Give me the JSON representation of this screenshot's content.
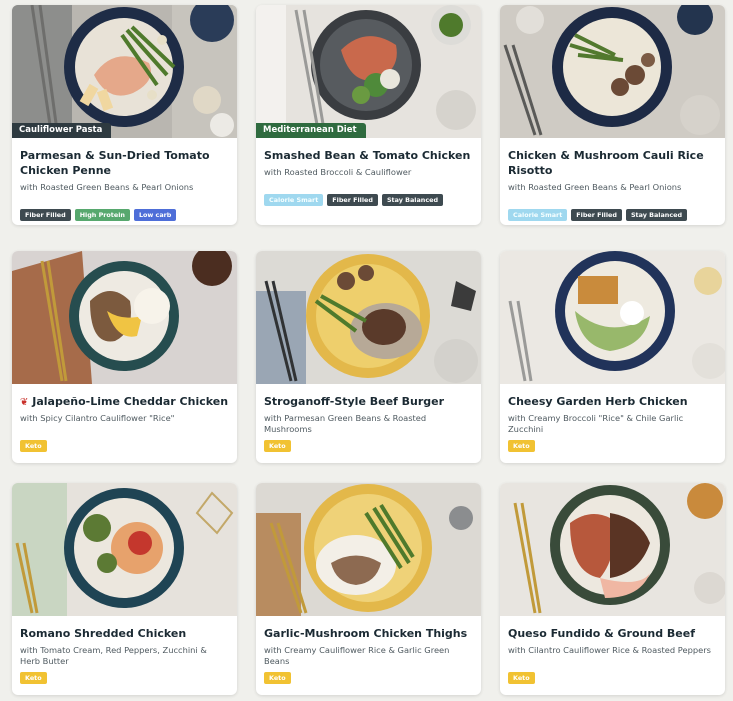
{
  "colors": {
    "background": "#f0f0ec",
    "cauliflower_pasta_tag": "#2e3a40",
    "mediterranean_tag": "#2f6b3f",
    "fiber_filled": "#3e4a50",
    "high_protein": "#57a86e",
    "low_carb": "#4e6ed8",
    "calorie_smart": "#9fd8ef",
    "stay_balanced": "#3e4a50",
    "keto": "#f1c232"
  },
  "meals": [
    {
      "diet_tag": "Cauliflower Pasta",
      "title": "Parmesan & Sun-Dried Tomato Chicken Penne",
      "subtitle": "with Roasted Green Beans & Pearl Onions",
      "badges": [
        "Fiber Filled",
        "High Protein",
        "Low carb"
      ]
    },
    {
      "diet_tag": "Mediterranean Diet",
      "title": "Smashed Bean & Tomato Chicken",
      "subtitle": "with Roasted Broccoli & Cauliflower",
      "badges": [
        "Calorie Smart",
        "Fiber Filled",
        "Stay Balanced"
      ]
    },
    {
      "title": "Chicken & Mushroom Cauli Rice Risotto",
      "subtitle": "with Roasted Green Beans & Pearl Onions",
      "badges": [
        "Calorie Smart",
        "Fiber Filled",
        "Stay Balanced"
      ]
    },
    {
      "title_icon": "chili-pepper-icon",
      "title": "Jalapeño-Lime Cheddar Chicken",
      "subtitle": "with Spicy Cilantro Cauliflower \"Rice\"",
      "badges": [
        "Keto"
      ]
    },
    {
      "title": "Stroganoff-Style Beef Burger",
      "subtitle": "with Parmesan Green Beans & Roasted Mushrooms",
      "badges": [
        "Keto"
      ]
    },
    {
      "title": "Cheesy Garden Herb Chicken",
      "subtitle": "with Creamy Broccoli \"Rice\" & Chile Garlic Zucchini",
      "badges": [
        "Keto"
      ]
    },
    {
      "title": "Romano Shredded Chicken",
      "subtitle": "with Tomato Cream, Red Peppers, Zucchini & Herb Butter",
      "badges": [
        "Keto"
      ]
    },
    {
      "title": "Garlic-Mushroom Chicken Thighs",
      "subtitle": "with Creamy Cauliflower Rice & Garlic Green Beans",
      "badges": [
        "Keto"
      ]
    },
    {
      "title": "Queso Fundido & Ground Beef",
      "subtitle": "with Cilantro Cauliflower Rice & Roasted Peppers",
      "badges": [
        "Keto"
      ]
    }
  ]
}
